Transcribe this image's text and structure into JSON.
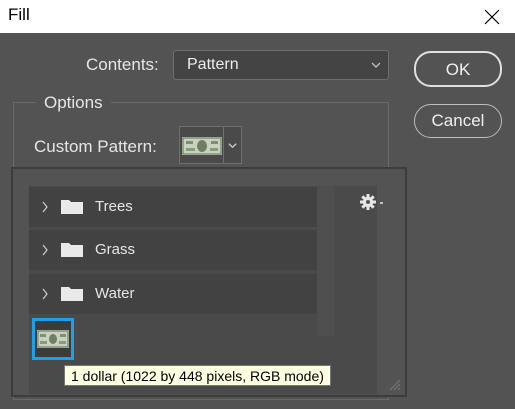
{
  "window": {
    "title": "Fill"
  },
  "contents": {
    "label": "Contents:",
    "value": "Pattern"
  },
  "buttons": {
    "ok": "OK",
    "cancel": "Cancel"
  },
  "options": {
    "legend": "Options",
    "custom_pattern_label": "Custom Pattern:"
  },
  "pattern_list": {
    "folders": [
      {
        "name": "Trees",
        "icon": "folder-icon"
      },
      {
        "name": "Grass",
        "icon": "folder-icon"
      },
      {
        "name": "Water",
        "icon": "folder-icon"
      }
    ],
    "selected_pattern_tooltip": "1 dollar (1022 by 448 pixels, RGB mode)"
  },
  "icons": {
    "close": "close-icon",
    "gear": "gear-icon",
    "chevron": "chevron-down-icon",
    "folder": "folder-icon"
  },
  "colors": {
    "dialog_bg": "#535353",
    "selection_accent": "#1ea0e8",
    "tooltip_bg": "#ffffe1"
  }
}
